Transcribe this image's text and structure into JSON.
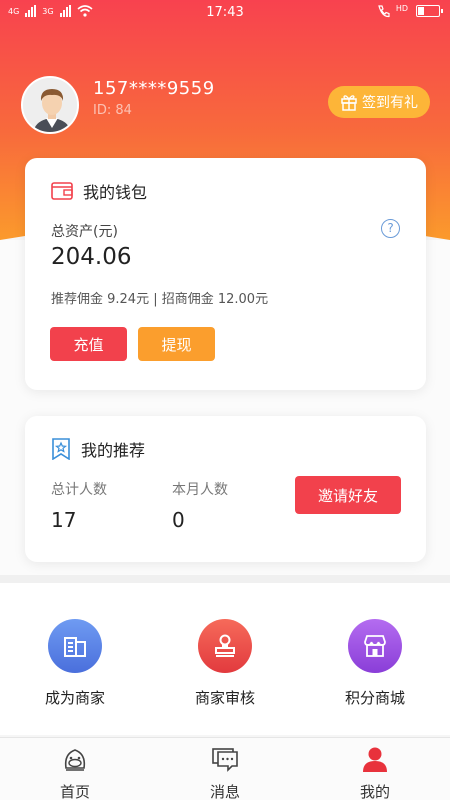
{
  "status_bar": {
    "network_left": "4G",
    "network_right": "3G",
    "time": "17:43",
    "hd": "HD"
  },
  "profile": {
    "phone": "157****9559",
    "id_label": "ID: 84",
    "signin_label": "签到有礼"
  },
  "wallet": {
    "title": "我的钱包",
    "assets_label": "总资产(元)",
    "assets_value": "204.06",
    "commission_text": "推荐佣金 9.24元 | 招商佣金 12.00元",
    "recharge_label": "充值",
    "withdraw_label": "提现",
    "help_glyph": "?"
  },
  "recommend": {
    "title": "我的推荐",
    "total_label": "总计人数",
    "total_value": "17",
    "month_label": "本月人数",
    "month_value": "0",
    "invite_label": "邀请好友"
  },
  "shortcuts": [
    {
      "label": "成为商家",
      "icon": "building-icon",
      "color": "#5a82e8"
    },
    {
      "label": "商家审核",
      "icon": "stamp-icon",
      "color": "#f04848"
    },
    {
      "label": "积分商城",
      "icon": "shop-icon",
      "color": "#9b52de"
    }
  ],
  "tabs": [
    {
      "label": "首页",
      "icon": "home-mascot-icon",
      "active": false
    },
    {
      "label": "消息",
      "icon": "message-icon",
      "active": false
    },
    {
      "label": "我的",
      "icon": "user-icon",
      "active": true
    }
  ],
  "colors": {
    "primary_red": "#f2414c",
    "orange": "#fb9e2d",
    "gold": "#fdb538",
    "active_tab": "#e8323c"
  }
}
